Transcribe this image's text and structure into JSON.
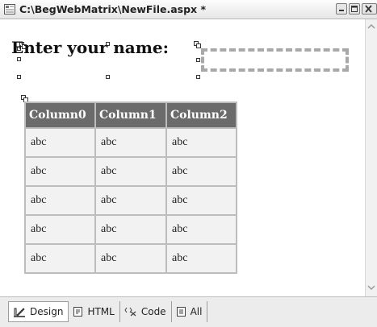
{
  "window": {
    "title": "C:\\BegWebMatrix\\NewFile.aspx *",
    "icons": {
      "document": "aspx-file-icon",
      "minimize": "minimize-icon",
      "maximize": "maximize-icon",
      "close": "close-icon"
    }
  },
  "design": {
    "label_text": "Enter your name:",
    "textbox_value": "",
    "grid": {
      "columns": [
        "Column0",
        "Column1",
        "Column2"
      ],
      "rows": [
        [
          "abc",
          "abc",
          "abc"
        ],
        [
          "abc",
          "abc",
          "abc"
        ],
        [
          "abc",
          "abc",
          "abc"
        ],
        [
          "abc",
          "abc",
          "abc"
        ],
        [
          "abc",
          "abc",
          "abc"
        ]
      ]
    }
  },
  "tabs": [
    {
      "label": "Design",
      "icon": "design-icon",
      "active": true
    },
    {
      "label": "HTML",
      "icon": "html-icon",
      "active": false
    },
    {
      "label": "Code",
      "icon": "code-icon",
      "active": false
    },
    {
      "label": "All",
      "icon": "all-icon",
      "active": false
    }
  ],
  "colors": {
    "grid_header": "#6b6b6b",
    "grid_cell": "#f2f2f2",
    "grid_border": "#bdbdbd",
    "selection_dash": "#a8a8a8"
  }
}
